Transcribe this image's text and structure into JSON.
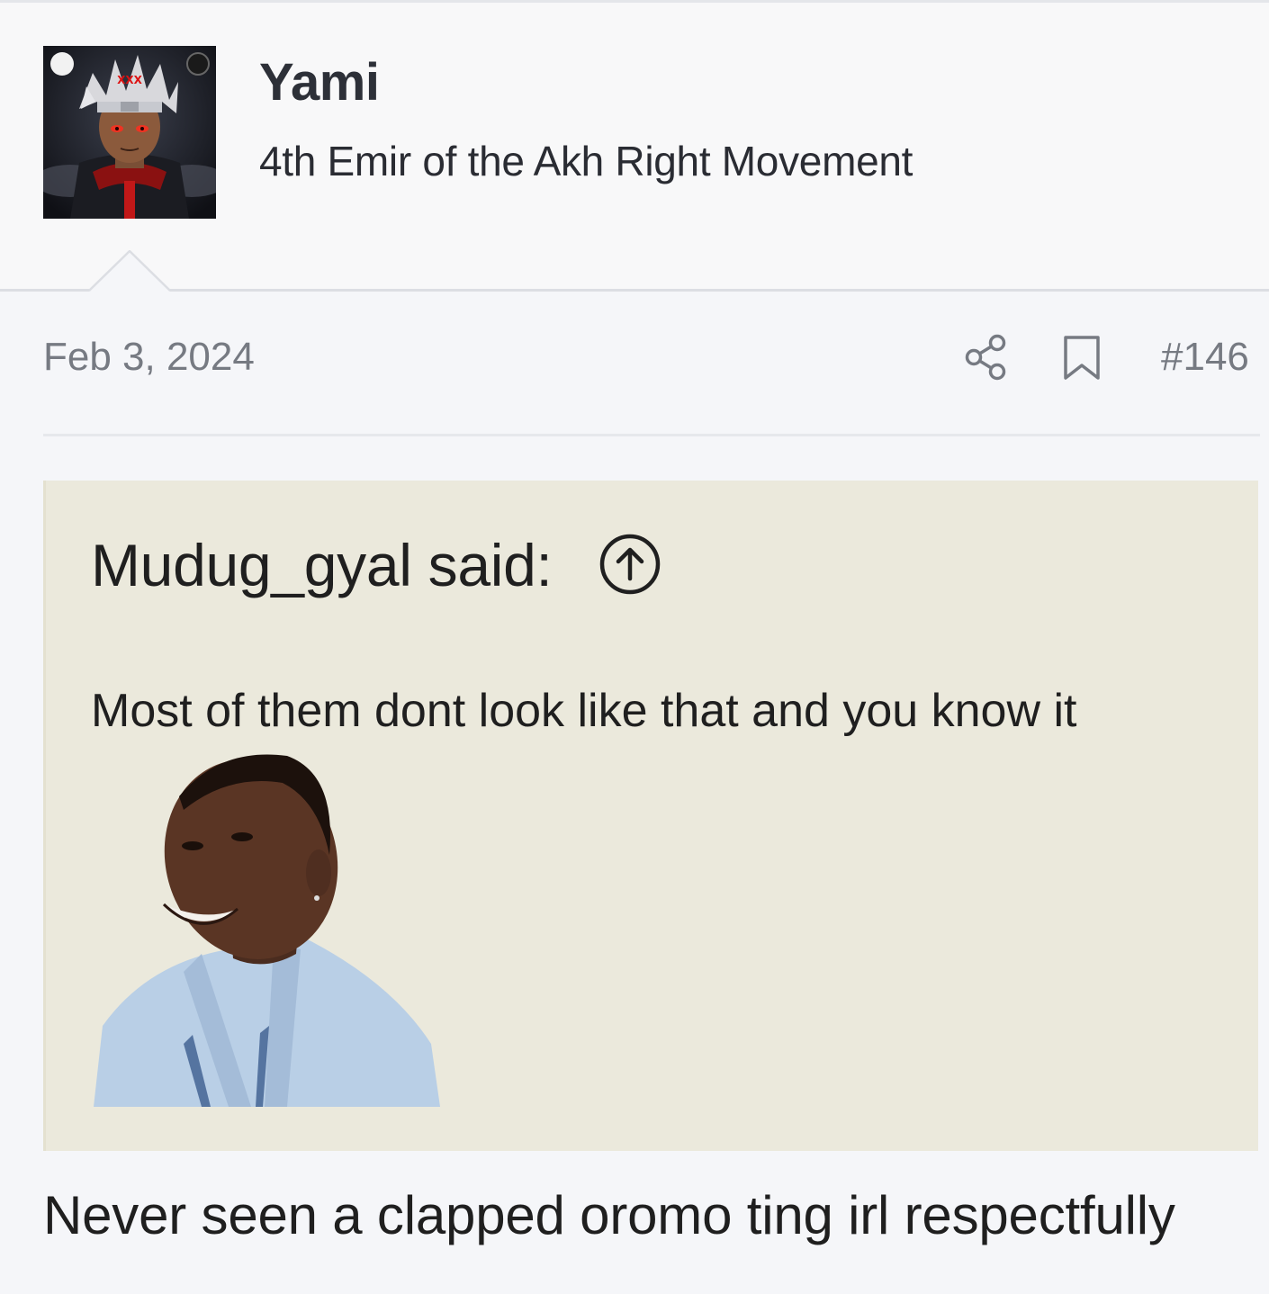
{
  "user": {
    "name": "Yami",
    "title": "4th Emir of the Akh Right Movement"
  },
  "post": {
    "date": "Feb 3, 2024",
    "number": "#146",
    "reply": "Never seen a clapped oromo ting irl respectfully"
  },
  "quote": {
    "author_label": "Mudug_gyal said:",
    "text": "Most of them dont look like that and you know it"
  },
  "icons": {
    "share": "share-icon",
    "bookmark": "bookmark-icon",
    "quote_jump": "arrow-up-circle-icon"
  },
  "colors": {
    "page_bg": "#f5f6f9",
    "header_bg": "#f8f8f9",
    "quote_bg": "#ebe9dc",
    "muted_text": "#767a82"
  }
}
